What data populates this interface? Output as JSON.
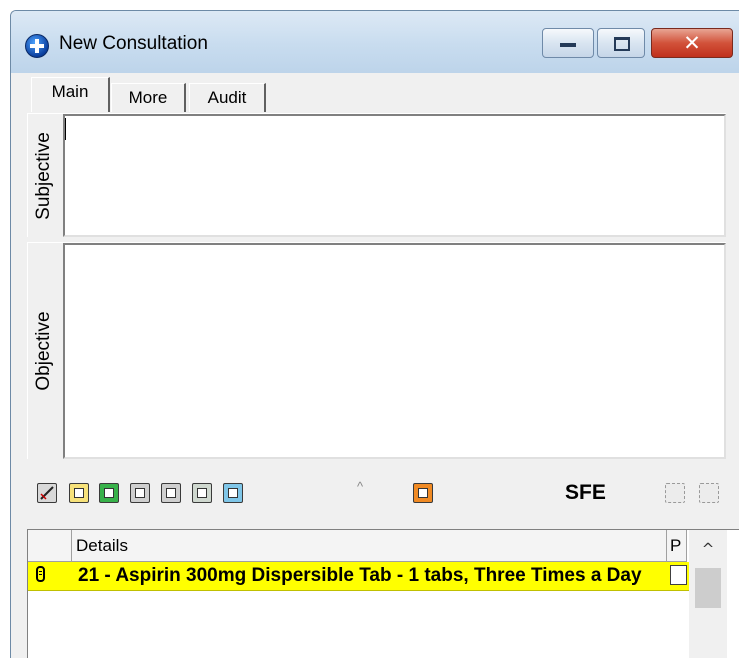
{
  "window": {
    "title": "New Consultation",
    "close_glyph": "✕",
    "app_icon": "consultation-globe-icon"
  },
  "tabs": [
    {
      "label": "Main",
      "selected": true
    },
    {
      "label": "More",
      "selected": false
    },
    {
      "label": "Audit",
      "selected": false
    }
  ],
  "sections": {
    "subjective": {
      "label": "Subjective",
      "value": ""
    },
    "objective": {
      "label": "Objective",
      "value": ""
    }
  },
  "toolbar": {
    "sfe_label": "SFE",
    "caret": "^",
    "icons": [
      "edit-note-icon",
      "document-list-icon",
      "green-prescription-icon",
      "printer-icon",
      "notes-icon",
      "attachment-icon",
      "checklist-icon",
      "orange-prescription-icon",
      "copy-disabled-icon",
      "paste-disabled-icon"
    ]
  },
  "grid": {
    "columns": {
      "details": "Details",
      "p": "P"
    },
    "scroll_up": "^",
    "rows": [
      {
        "details": "21 - Aspirin 300mg Dispersible Tab - 1 tabs, Three Times a Day",
        "p": false,
        "highlight": "#ffff00"
      }
    ]
  }
}
